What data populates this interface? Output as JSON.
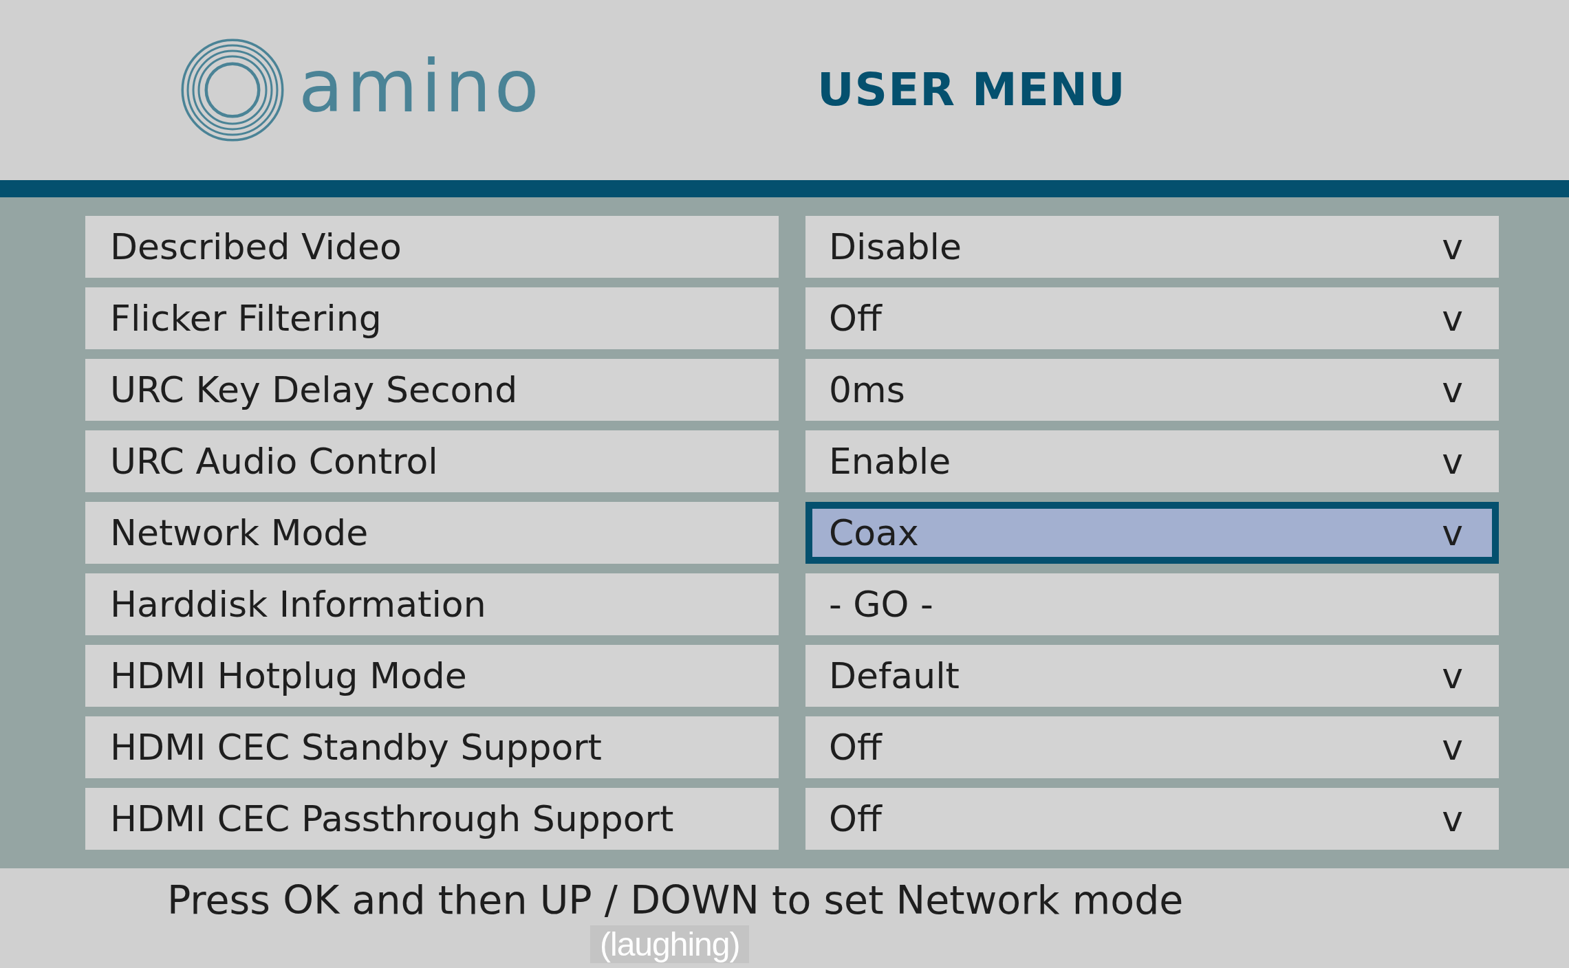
{
  "header": {
    "logo_text": "amino",
    "title": "USER MENU"
  },
  "settings": [
    {
      "label": "Described Video",
      "value": "Disable",
      "arrow": "v",
      "selected": false
    },
    {
      "label": "Flicker Filtering",
      "value": "Off",
      "arrow": "v",
      "selected": false
    },
    {
      "label": "URC Key Delay Second",
      "value": "0ms",
      "arrow": "v",
      "selected": false
    },
    {
      "label": "URC Audio Control",
      "value": "Enable",
      "arrow": "v",
      "selected": false
    },
    {
      "label": "Network Mode",
      "value": "Coax",
      "arrow": "v",
      "selected": true
    },
    {
      "label": "Harddisk Information",
      "value": "- GO -",
      "selected": false
    },
    {
      "label": "HDMI Hotplug Mode",
      "value": "Default",
      "arrow": "v",
      "selected": false
    },
    {
      "label": "HDMI CEC Standby Support",
      "value": "Off",
      "arrow": "v",
      "selected": false
    },
    {
      "label": "HDMI CEC Passthrough Support",
      "value": "Off",
      "arrow": "v",
      "selected": false
    }
  ],
  "hint": "Press OK and then UP / DOWN to set Network mode",
  "caption": "(laughing)"
}
